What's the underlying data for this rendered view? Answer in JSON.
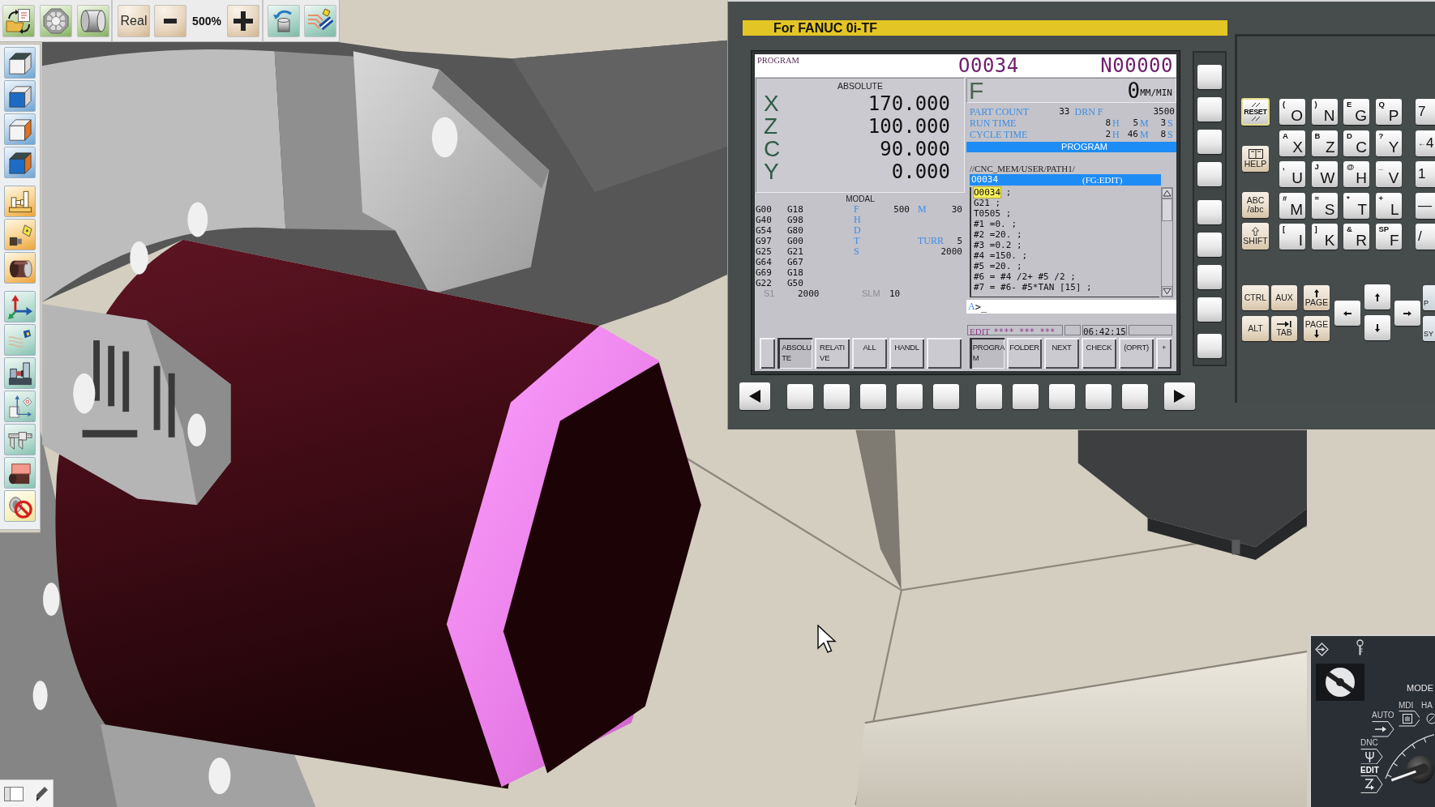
{
  "top_toolbar": {
    "scale_button": "Real",
    "zoom_level": "500%"
  },
  "cnc_window": {
    "title": "For FANUC 0i-TF",
    "screen": {
      "screen_title": "PROGRAM",
      "program_number": "O0034",
      "sequence_number": "N00000",
      "position": {
        "title": "ABSOLUTE",
        "axes": [
          {
            "axis": "X",
            "value": "170.000"
          },
          {
            "axis": "Z",
            "value": "100.000"
          },
          {
            "axis": "C",
            "value": "90.000"
          },
          {
            "axis": "Y",
            "value": "0.000"
          }
        ]
      },
      "modal": {
        "title": "MODAL",
        "rows": [
          {
            "g_codes": [
              "G00",
              "G18"
            ],
            "address": "F",
            "value": "500",
            "sub_address": "M",
            "sub_value": "30"
          },
          {
            "g_codes": [
              "G40",
              "G98"
            ],
            "address": "H"
          },
          {
            "g_codes": [
              "G54",
              "G80"
            ],
            "address": "D"
          },
          {
            "g_codes": [
              "G97",
              "G00"
            ],
            "address": "T",
            "sub_address": "TURR",
            "sub_value": "5"
          },
          {
            "g_codes": [
              "G25",
              "G21"
            ],
            "address": "S",
            "sub_value": "2000"
          },
          {
            "g_codes": [
              "G64",
              "G67"
            ]
          },
          {
            "g_codes": [
              "G69",
              "G18"
            ]
          },
          {
            "g_codes": [
              "G22",
              "G50"
            ]
          }
        ],
        "spindle": {
          "label": "S1",
          "value": "2000",
          "limit_label": "SLM",
          "limit_value": "10"
        }
      },
      "feed": {
        "label": "F",
        "value": "0",
        "unit": "MM/MIN"
      },
      "counters": [
        {
          "kind": "count",
          "label": "PART COUNT",
          "value": "33",
          "sub_label": "DRN F",
          "sub_value": "3500"
        },
        {
          "kind": "time",
          "label": "RUN TIME",
          "parts": [
            {
              "value": "8",
              "unit": "H"
            },
            {
              "value": "5",
              "unit": "M"
            },
            {
              "value": "3",
              "unit": "S"
            }
          ]
        },
        {
          "kind": "time",
          "label": "CYCLE TIME",
          "parts": [
            {
              "value": "2",
              "unit": "H"
            },
            {
              "value": "46",
              "unit": "M"
            },
            {
              "value": "8",
              "unit": "S"
            }
          ]
        }
      ],
      "program": {
        "title": "PROGRAM",
        "path": "//CNC_MEM/USER/PATH1/",
        "name": "O0034",
        "edit_mode": "(FG:EDIT)",
        "lines": [
          {
            "code": "O0034",
            "end": ";",
            "selected": true
          },
          {
            "code": "G21",
            "end": ";",
            "selected": false
          },
          {
            "code": "T0505",
            "end": ";",
            "selected": false
          },
          {
            "code": "#1 =0.",
            "end": ";",
            "selected": false
          },
          {
            "code": "#2 =20.",
            "end": ";",
            "selected": false
          },
          {
            "code": "#3 =0.2",
            "end": ";",
            "selected": false
          },
          {
            "code": "#4 =150.",
            "end": ";",
            "selected": false
          },
          {
            "code": "#5 =20.",
            "end": ";",
            "selected": false
          },
          {
            "code": "#6 = #4 /2+ #5 /2",
            "end": ";",
            "selected": false
          },
          {
            "code": "#7 = #6- #5*TAN [15]",
            "end": ";",
            "selected": false
          }
        ]
      },
      "input": {
        "label": "A",
        "text": ">_"
      },
      "status": {
        "mode": "EDIT",
        "flags": "**** *** ***",
        "time": "06:42:15"
      },
      "softkeys": [
        {
          "kind": "back",
          "selected": false
        },
        {
          "kind": "label",
          "label": "ABSOLU\nTE",
          "selected": true
        },
        {
          "kind": "label",
          "label": "RELATI\nVE",
          "selected": false
        },
        {
          "kind": "label",
          "label": "ALL",
          "selected": false
        },
        {
          "kind": "label",
          "label": "HANDL",
          "selected": false
        },
        {
          "kind": "blank",
          "selected": false
        },
        {
          "kind": "label",
          "label": "PROGRA\nM",
          "selected": true
        },
        {
          "kind": "label",
          "label": "FOLDER",
          "selected": false
        },
        {
          "kind": "label",
          "label": "NEXT",
          "selected": false
        },
        {
          "kind": "label",
          "label": "CHECK",
          "selected": false
        },
        {
          "kind": "label",
          "label": "(OPRT)",
          "selected": false
        },
        {
          "kind": "more",
          "label": "+",
          "selected": false
        }
      ]
    },
    "keypad": {
      "function_keys": [
        {
          "kind": "reset",
          "label": "RESET"
        },
        {
          "kind": "help",
          "label": "HELP"
        },
        {
          "kind": "case",
          "label": "ABC\n/abc"
        },
        {
          "kind": "shift",
          "label": "SHIFT"
        }
      ],
      "letter_rows": [
        [
          {
            "sub": "(",
            "main": "O"
          },
          {
            "sub": ")",
            "main": "N"
          },
          {
            "sub": "E",
            "main": "G"
          },
          {
            "sub": "Q",
            "main": "P"
          }
        ],
        [
          {
            "sub": "A",
            "main": "X"
          },
          {
            "sub": "B",
            "main": "Z"
          },
          {
            "sub": "D",
            "main": "C"
          },
          {
            "sub": "?",
            "main": "Y"
          }
        ],
        [
          {
            "sub": ",",
            "main": "U"
          },
          {
            "sub": "J",
            "main": "W"
          },
          {
            "sub": "@",
            "main": "H"
          },
          {
            "sub": "_",
            "main": "V"
          }
        ],
        [
          {
            "sub": "#",
            "main": "M"
          },
          {
            "sub": "=",
            "main": "S"
          },
          {
            "sub": "*",
            "main": "T"
          },
          {
            "sub": "+",
            "main": "L"
          }
        ],
        [
          {
            "sub": "[",
            "main": "I"
          },
          {
            "sub": "]",
            "main": "K"
          },
          {
            "sub": "&",
            "main": "R"
          },
          {
            "sub": "SP",
            "main": "F"
          }
        ]
      ],
      "number_keys": [
        {
          "main": "7"
        },
        {
          "sub": "←",
          "main": "4"
        },
        {
          "main": "1"
        },
        {
          "main": "—"
        },
        {
          "main": "/"
        }
      ],
      "edit_keys": [
        {
          "kind": "plain",
          "label": "CTRL"
        },
        {
          "kind": "plain",
          "label": "ALT"
        },
        {
          "kind": "plain",
          "label": "AUX"
        },
        {
          "kind": "tab",
          "label": "TAB"
        },
        {
          "kind": "page_up",
          "label": "PAGE"
        },
        {
          "kind": "page_down",
          "label": "PAGE"
        }
      ],
      "edge_keys": [
        "P",
        "SY"
      ]
    }
  },
  "operator_panel": {
    "title": "MODE",
    "modes": [
      {
        "kind": "auto",
        "label": "AUTO",
        "selected": false
      },
      {
        "kind": "mdi",
        "label": "MDI",
        "selected": false
      },
      {
        "kind": "handle",
        "label": "HA",
        "selected": false
      },
      {
        "kind": "dnc",
        "label": "DNC",
        "selected": false
      },
      {
        "kind": "edit",
        "label": "EDIT",
        "selected": true
      }
    ]
  }
}
